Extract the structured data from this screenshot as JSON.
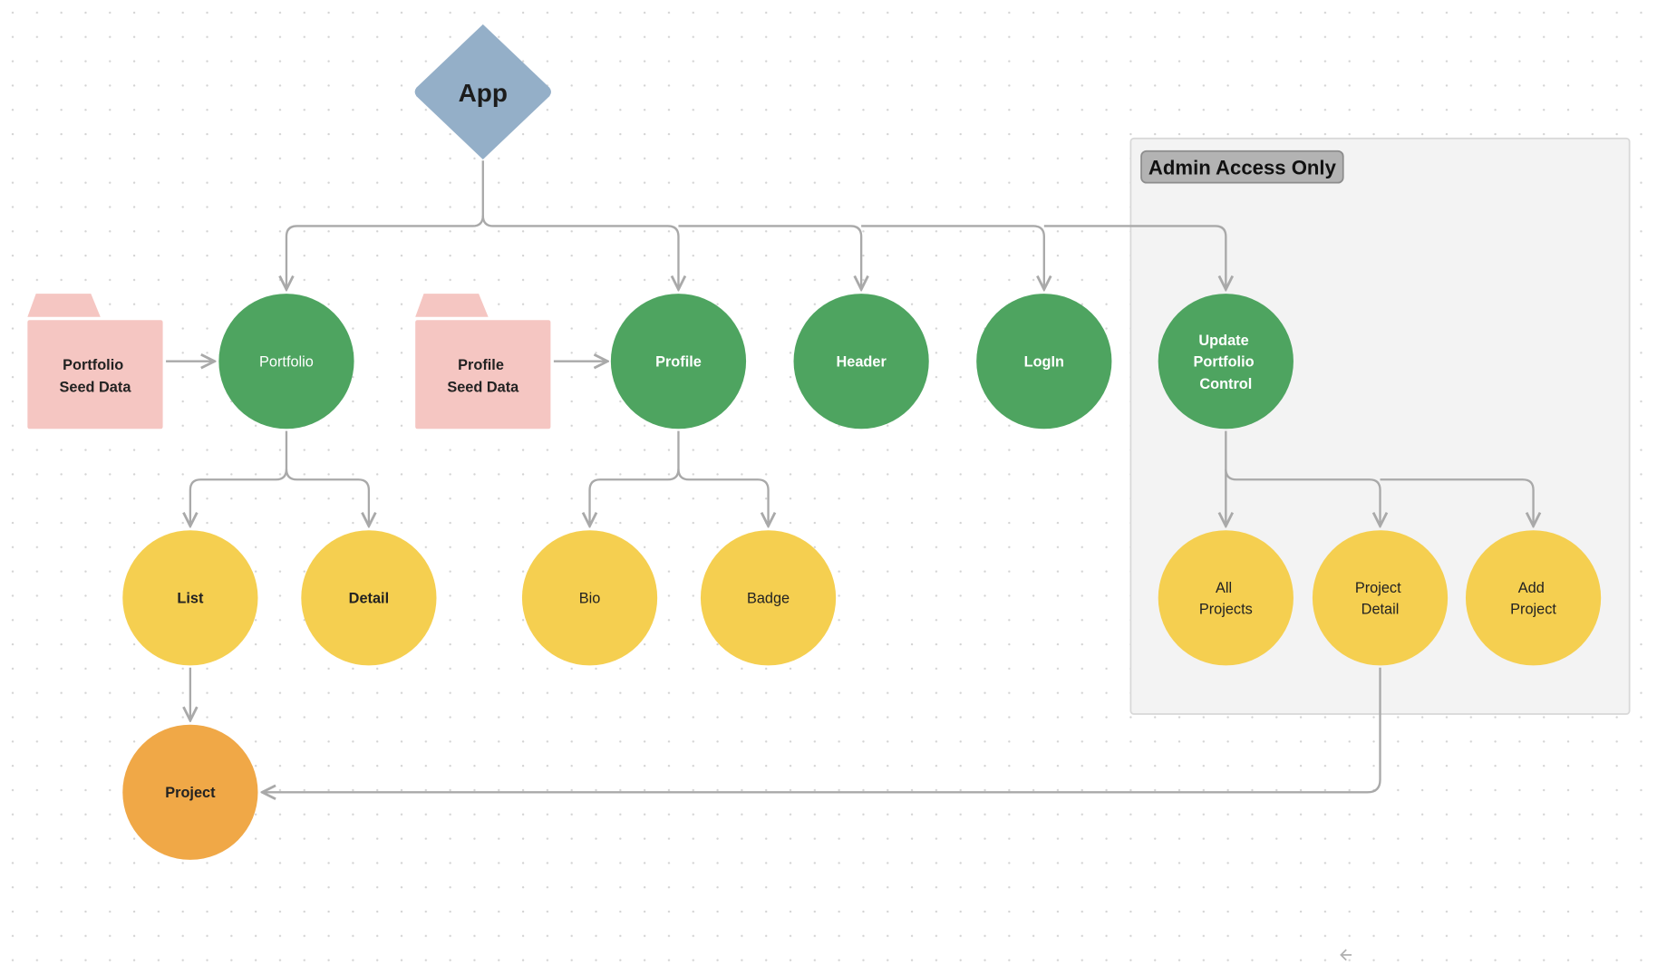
{
  "colors": {
    "root": "#94afc8",
    "component": "#4ea460",
    "subcomponent": "#f5cf50",
    "leaf": "#f0a847",
    "seed_data": "#f5c6c2",
    "edge": "#a9a9a9",
    "admin_region": "#f3f3f3",
    "admin_label": "#b3b3b3"
  },
  "root": {
    "label": "App"
  },
  "seed_data": [
    {
      "line1": "Portfolio",
      "line2": "Seed Data"
    },
    {
      "line1": "Profile",
      "line2": "Seed Data"
    }
  ],
  "components": [
    {
      "label": "Portfolio"
    },
    {
      "label": "Profile"
    },
    {
      "label": "Header"
    },
    {
      "label": "LogIn"
    },
    {
      "line1": "Update",
      "line2": "Portfolio",
      "line3": "Control"
    }
  ],
  "subcomponents": [
    {
      "label": "List"
    },
    {
      "label": "Detail"
    },
    {
      "label": "Bio"
    },
    {
      "label": "Badge"
    },
    {
      "line1": "All",
      "line2": "Projects"
    },
    {
      "line1": "Project",
      "line2": "Detail"
    },
    {
      "line1": "Add",
      "line2": "Project"
    }
  ],
  "leaf": {
    "label": "Project"
  },
  "admin_group": {
    "label": "Admin Access Only"
  },
  "icons": {
    "canvas_arrow": "arrow-left-icon"
  }
}
